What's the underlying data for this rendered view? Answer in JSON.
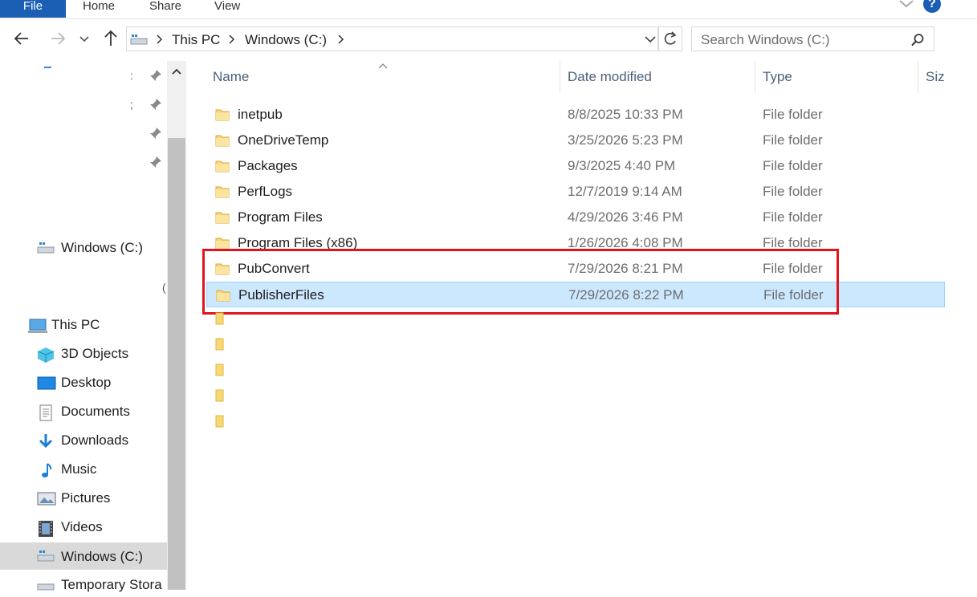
{
  "ribbon": {
    "tabs": [
      "File",
      "Home",
      "Share",
      "View"
    ],
    "help_label": "?"
  },
  "address": {
    "crumbs": [
      "This PC",
      "Windows (C:)"
    ],
    "search_placeholder": "Search Windows (C:)"
  },
  "navpane": {
    "drive_label": "Windows (C:)",
    "items": [
      {
        "label": "This PC",
        "icon": "this-pc-icon"
      },
      {
        "label": "3D Objects",
        "icon": "3d-objects-icon"
      },
      {
        "label": "Desktop",
        "icon": "desktop-icon"
      },
      {
        "label": "Documents",
        "icon": "documents-icon"
      },
      {
        "label": "Downloads",
        "icon": "downloads-icon"
      },
      {
        "label": "Music",
        "icon": "music-icon"
      },
      {
        "label": "Pictures",
        "icon": "pictures-icon"
      },
      {
        "label": "Videos",
        "icon": "videos-icon"
      },
      {
        "label": "Windows (C:)",
        "icon": "drive-icon"
      },
      {
        "label": "Temporary Stora",
        "icon": "drive-icon"
      }
    ]
  },
  "columns": {
    "name": "Name",
    "date": "Date modified",
    "type": "Type",
    "size": "Size"
  },
  "files": [
    {
      "name": "inetpub",
      "date": "8/8/2025 10:33 PM",
      "type": "File folder"
    },
    {
      "name": "OneDriveTemp",
      "date": "3/25/2026 5:23 PM",
      "type": "File folder"
    },
    {
      "name": "Packages",
      "date": "9/3/2025 4:40 PM",
      "type": "File folder"
    },
    {
      "name": "PerfLogs",
      "date": "12/7/2019 9:14 AM",
      "type": "File folder"
    },
    {
      "name": "Program Files",
      "date": "4/29/2026 3:46 PM",
      "type": "File folder"
    },
    {
      "name": "Program Files (x86)",
      "date": "1/26/2026 4:08 PM",
      "type": "File folder"
    },
    {
      "name": "PubConvert",
      "date": "7/29/2026 8:21 PM",
      "type": "File folder"
    },
    {
      "name": "PublisherFiles",
      "date": "7/29/2026 8:22 PM",
      "type": "File folder"
    }
  ],
  "colors": {
    "accent": "#1a5fb4",
    "selection": "#cce8ff",
    "highlight_box": "#e0141e",
    "folder": "#f8d775"
  }
}
